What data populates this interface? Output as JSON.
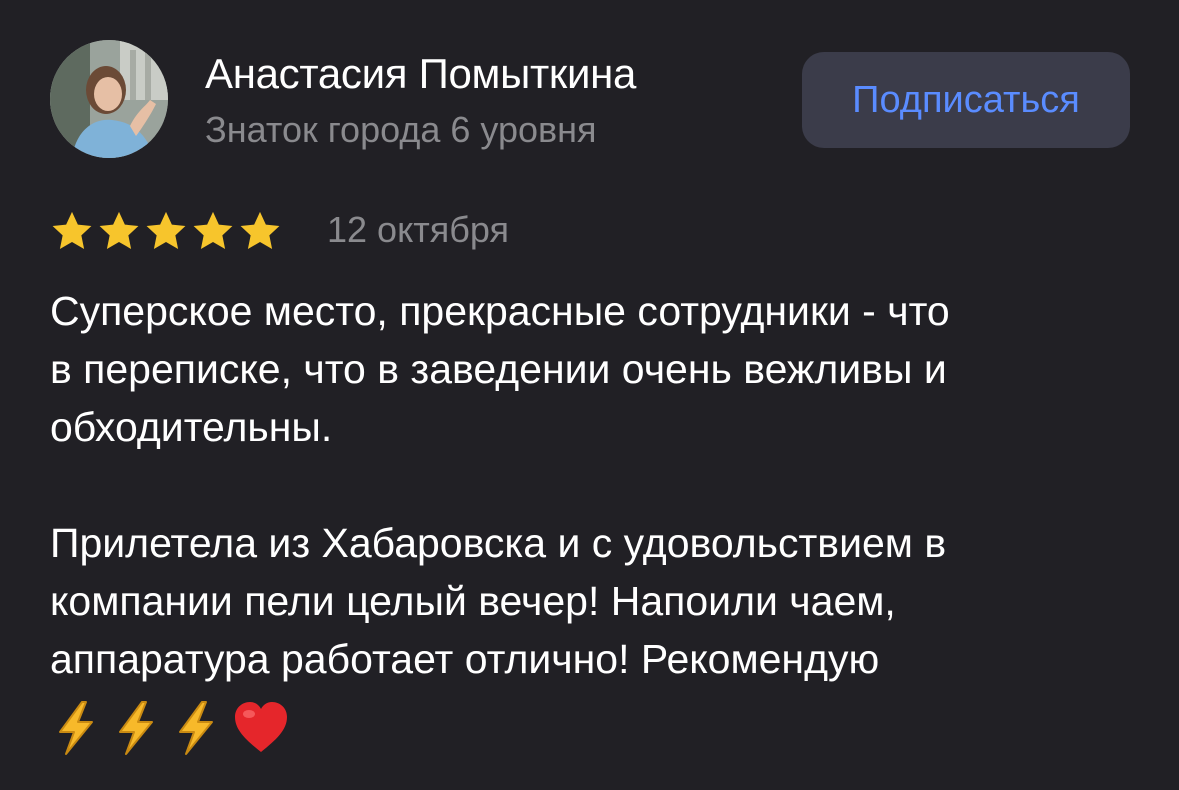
{
  "author": {
    "name": "Анастасия Помыткина",
    "level": "Знаток города 6 уровня",
    "avatar_icon": "user-photo-avatar"
  },
  "subscribe_button": {
    "label": "Подписаться"
  },
  "review": {
    "rating": 5,
    "rating_max": 5,
    "date": "12 октября",
    "paragraphs": [
      "Суперское место, прекрасные сотрудники - что\nв переписке, что в заведении очень вежливы и\nобходительны.",
      "Прилетела из Хабаровска и с удовольствием в\nкомпании пели целый вечер! Напоили чаем,\nаппаратура работает отлично! Рекомендую"
    ],
    "emojis": [
      "lightning-icon",
      "lightning-icon",
      "lightning-icon",
      "red-heart-icon"
    ]
  },
  "colors": {
    "background": "#212025",
    "star": "#f7c52c",
    "button_bg": "#3b3c4a",
    "button_text": "#5a8cff",
    "secondary_text": "#8a8a8e"
  }
}
